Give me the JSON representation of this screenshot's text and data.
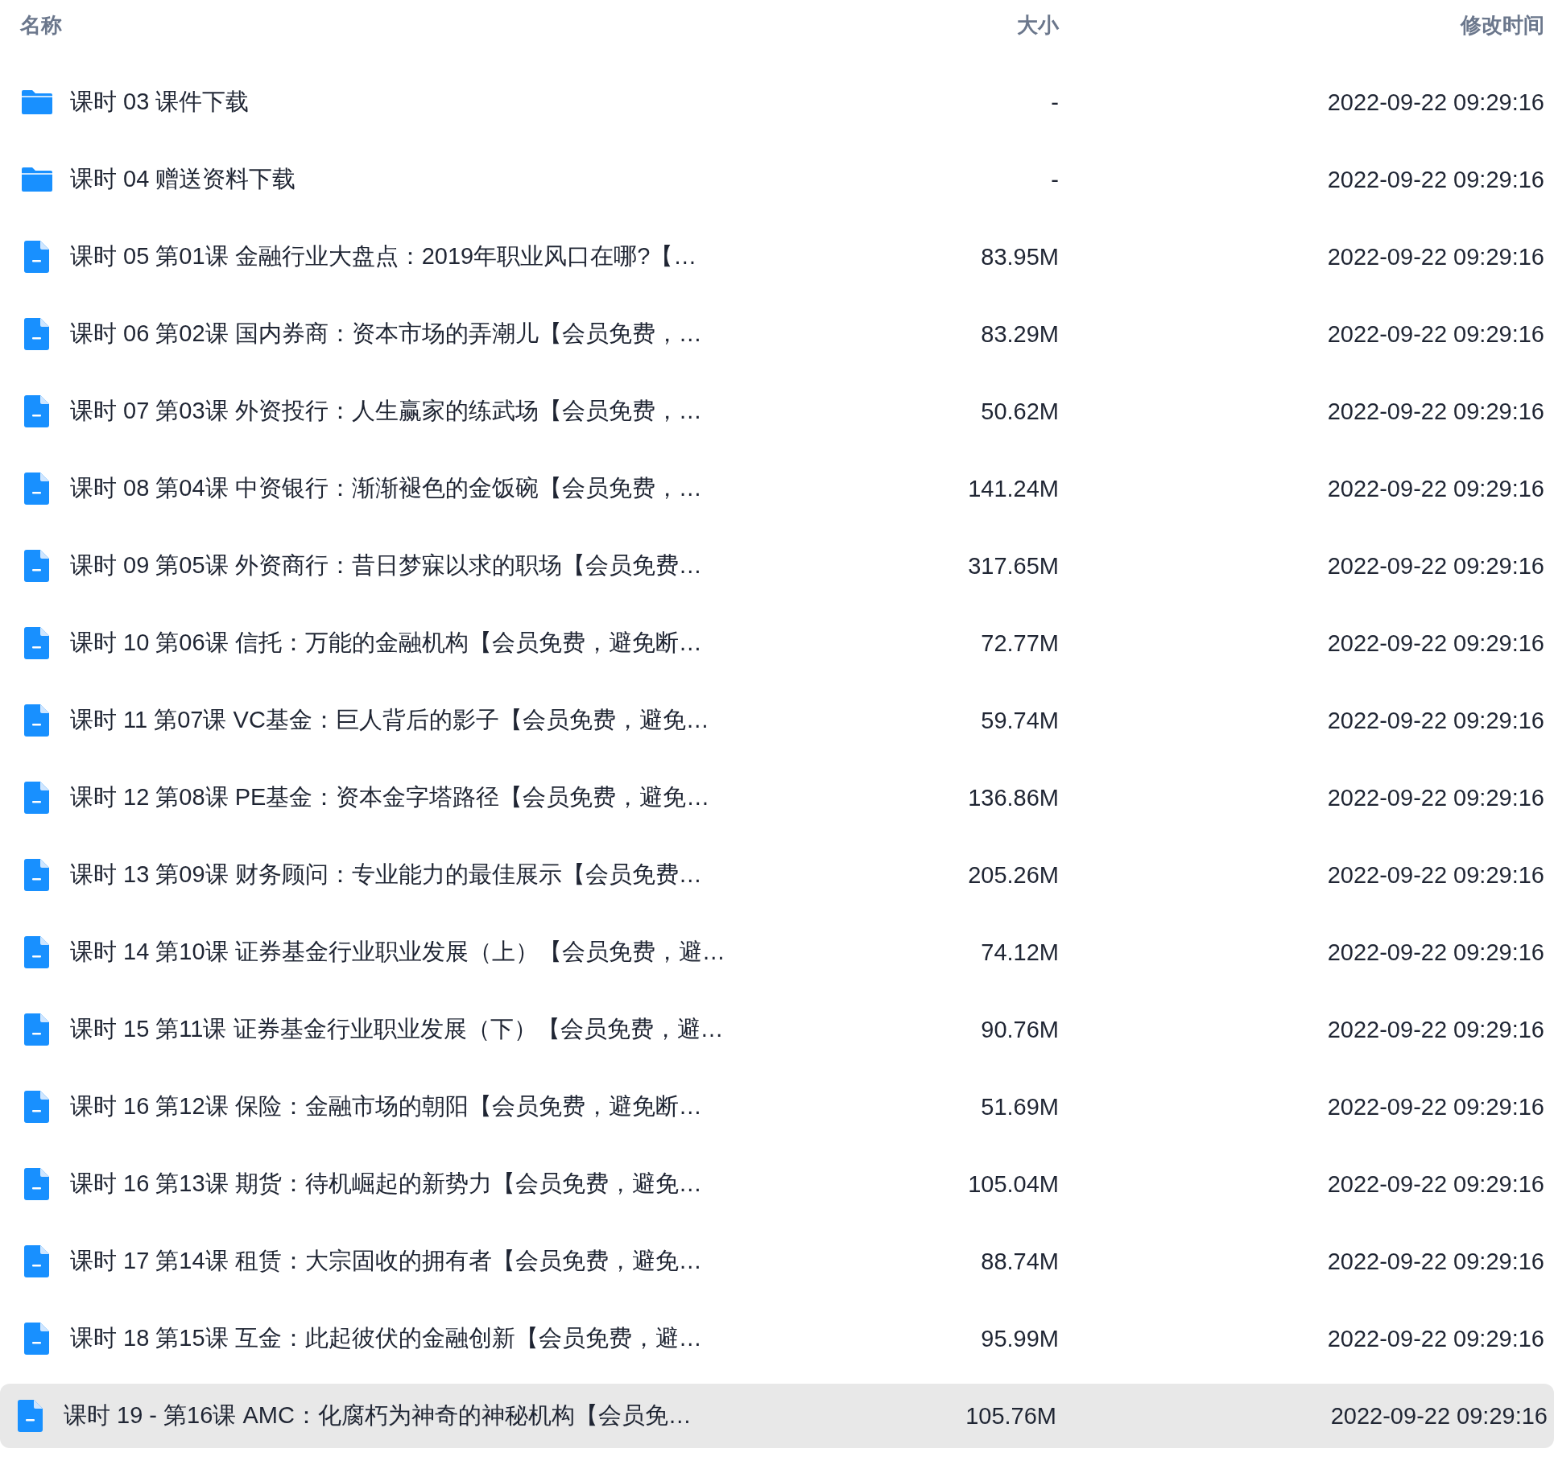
{
  "columns": [
    "名称",
    "大小",
    "修改时间"
  ],
  "rows": [
    {
      "kind": "folder",
      "name": "课时 03 课件下载",
      "size": "-",
      "modified": "2022-09-22 09:29:16",
      "selected": false
    },
    {
      "kind": "folder",
      "name": "课时 04 赠送资料下载",
      "size": "-",
      "modified": "2022-09-22 09:29:16",
      "selected": false
    },
    {
      "kind": "file",
      "name": "课时 05 第01课 金融行业大盘点：2019年职业风口在哪?【…",
      "size": "83.95M",
      "modified": "2022-09-22 09:29:16",
      "selected": false
    },
    {
      "kind": "file",
      "name": "课时 06 第02课 国内券商：资本市场的弄潮儿【会员免费，…",
      "size": "83.29M",
      "modified": "2022-09-22 09:29:16",
      "selected": false
    },
    {
      "kind": "file",
      "name": "课时 07 第03课 外资投行：人生赢家的练武场【会员免费，…",
      "size": "50.62M",
      "modified": "2022-09-22 09:29:16",
      "selected": false
    },
    {
      "kind": "file",
      "name": "课时 08 第04课 中资银行：渐渐褪色的金饭碗【会员免费，…",
      "size": "141.24M",
      "modified": "2022-09-22 09:29:16",
      "selected": false
    },
    {
      "kind": "file",
      "name": "课时 09 第05课 外资商行：昔日梦寐以求的职场【会员免费…",
      "size": "317.65M",
      "modified": "2022-09-22 09:29:16",
      "selected": false
    },
    {
      "kind": "file",
      "name": "课时 10 第06课 信托：万能的金融机构【会员免费，避免断…",
      "size": "72.77M",
      "modified": "2022-09-22 09:29:16",
      "selected": false
    },
    {
      "kind": "file",
      "name": "课时 11 第07课 VC基金：巨人背后的影子【会员免费，避免…",
      "size": "59.74M",
      "modified": "2022-09-22 09:29:16",
      "selected": false
    },
    {
      "kind": "file",
      "name": "课时 12 第08课 PE基金：资本金字塔路径【会员免费，避免…",
      "size": "136.86M",
      "modified": "2022-09-22 09:29:16",
      "selected": false
    },
    {
      "kind": "file",
      "name": "课时 13 第09课 财务顾问：专业能力的最佳展示【会员免费…",
      "size": "205.26M",
      "modified": "2022-09-22 09:29:16",
      "selected": false
    },
    {
      "kind": "file",
      "name": "课时 14 第10课 证券基金行业职业发展（上）【会员免费，避…",
      "size": "74.12M",
      "modified": "2022-09-22 09:29:16",
      "selected": false
    },
    {
      "kind": "file",
      "name": "课时 15 第11课 证券基金行业职业发展（下）【会员免费，避…",
      "size": "90.76M",
      "modified": "2022-09-22 09:29:16",
      "selected": false
    },
    {
      "kind": "file",
      "name": "课时 16 第12课 保险：金融市场的朝阳【会员免费，避免断…",
      "size": "51.69M",
      "modified": "2022-09-22 09:29:16",
      "selected": false
    },
    {
      "kind": "file",
      "name": "课时 16 第13课 期货：待机崛起的新势力【会员免费，避免…",
      "size": "105.04M",
      "modified": "2022-09-22 09:29:16",
      "selected": false
    },
    {
      "kind": "file",
      "name": "课时 17 第14课 租赁：大宗固收的拥有者【会员免费，避免…",
      "size": "88.74M",
      "modified": "2022-09-22 09:29:16",
      "selected": false
    },
    {
      "kind": "file",
      "name": "课时 18 第15课 互金：此起彼伏的金融创新【会员免费，避…",
      "size": "95.99M",
      "modified": "2022-09-22 09:29:16",
      "selected": false
    },
    {
      "kind": "file",
      "name": "课时 19 - 第16课 AMC：化腐朽为神奇的神秘机构【会员免…",
      "size": "105.76M",
      "modified": "2022-09-22 09:29:16",
      "selected": true
    }
  ]
}
